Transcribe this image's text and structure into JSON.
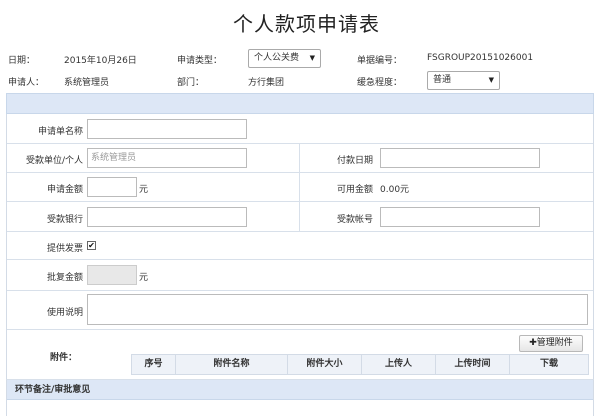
{
  "title": "个人款项申请表",
  "header": {
    "date_label": "日期：",
    "date_value": "2015年10月26日",
    "type_label": "申请类型：",
    "type_value": "个人公关费",
    "doc_no_label": "单据编号：",
    "doc_no_value": "FSGROUP20151026001",
    "applicant_label": "申请人：",
    "applicant_value": "系统管理员",
    "dept_label": "部门：",
    "dept_value": "方行集团",
    "urgency_label": "缓急程度：",
    "urgency_value": "普通"
  },
  "form": {
    "order_name_label": "申请单名称",
    "order_name_value": "",
    "payee_label": "受款单位/个人",
    "payee_placeholder": "系统管理员",
    "pay_date_label": "付款日期",
    "pay_date_value": "",
    "amount_label": "申请金额",
    "amount_value": "",
    "amount_unit": "元",
    "available_label": "可用金额",
    "available_value": "0.00元",
    "bank_label": "受款银行",
    "bank_value": "",
    "account_label": "受款帐号",
    "account_value": "",
    "invoice_label": "提供发票",
    "invoice_checked": true,
    "approved_label": "批复金额",
    "approved_value": "",
    "approved_unit": "元",
    "usage_label": "使用说明",
    "usage_value": ""
  },
  "attachments": {
    "label": "附件：",
    "manage_button": "管理附件",
    "columns": [
      "序号",
      "附件名称",
      "附件大小",
      "上传人",
      "上传时间",
      "下载"
    ]
  },
  "notes": {
    "title": "环节备注/审批意见"
  }
}
